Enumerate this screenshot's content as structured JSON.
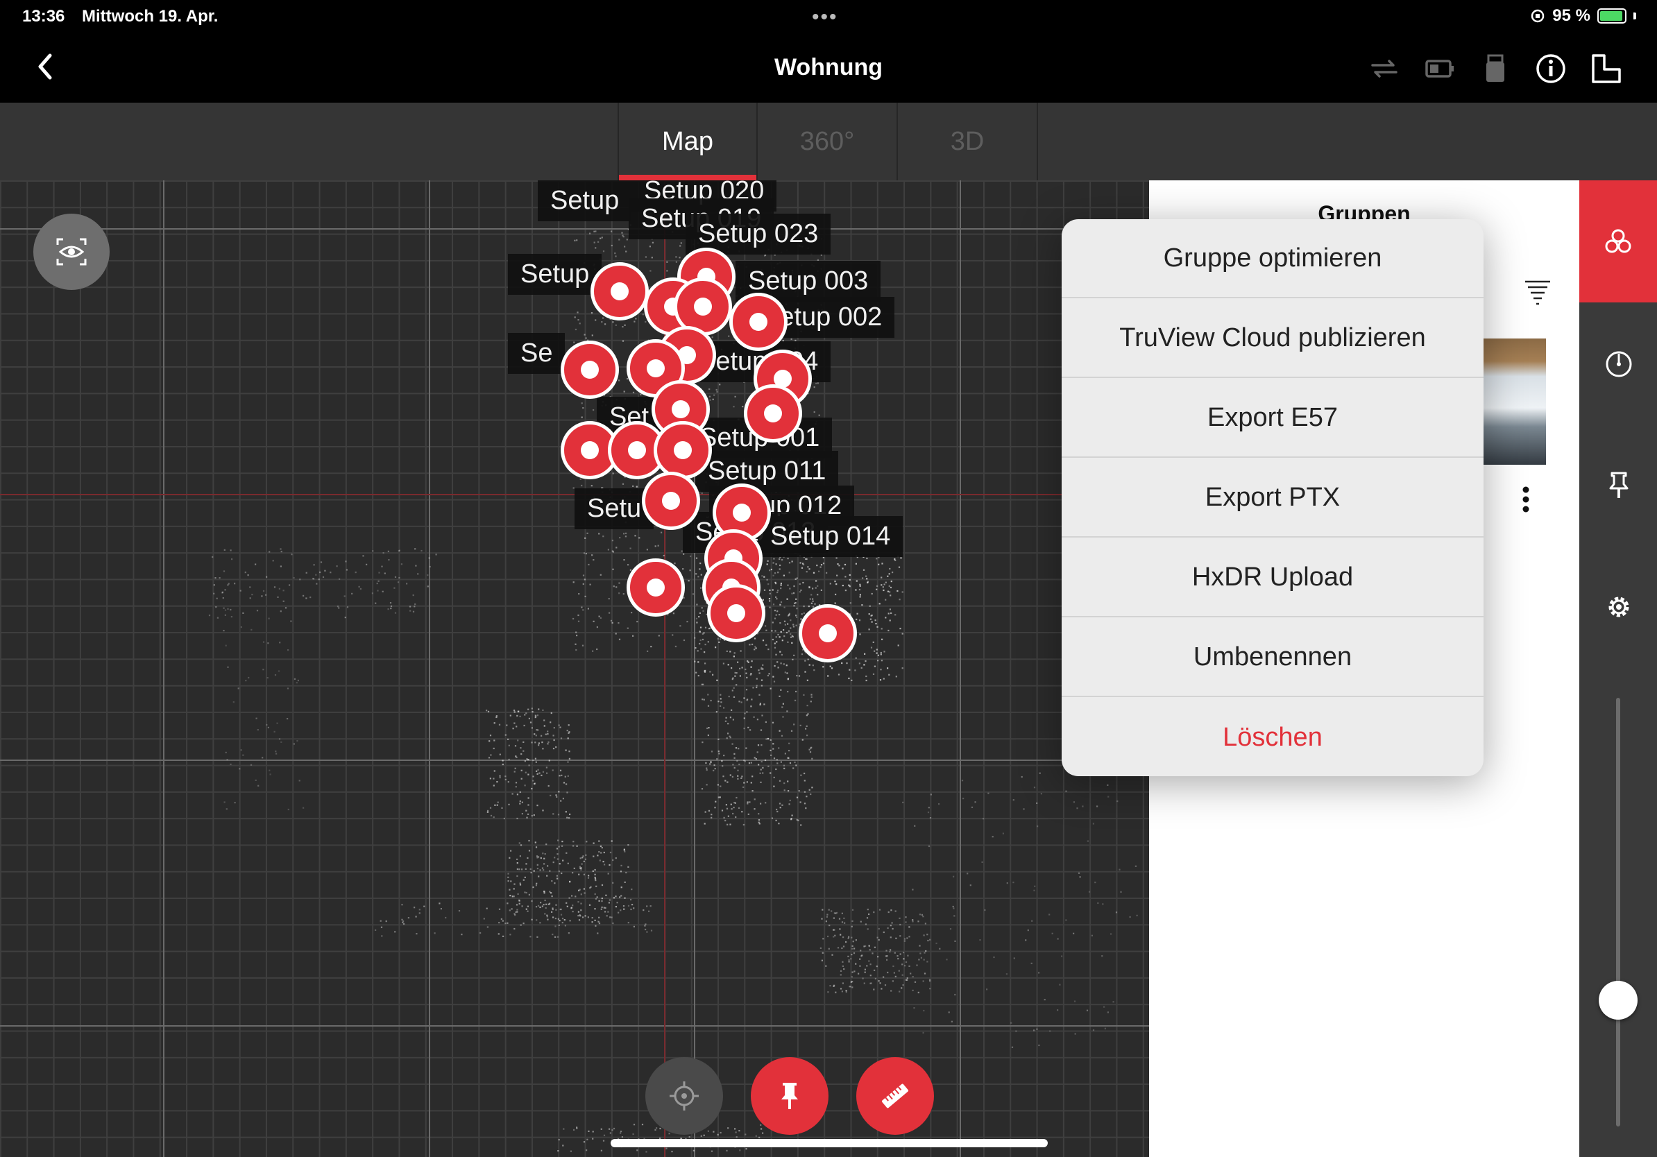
{
  "status_bar": {
    "time": "13:36",
    "date": "Mittwoch 19. Apr.",
    "dots": "•••",
    "battery_percent": "95 %"
  },
  "nav": {
    "back_icon": "chevron-left-icon",
    "title": "Wohnung",
    "icons": [
      "sync-icon",
      "battery-device-icon",
      "usb-device-icon",
      "info-icon",
      "layout-icon"
    ]
  },
  "tabs": [
    {
      "label": "Map",
      "active": true
    },
    {
      "label": "360°",
      "active": false
    },
    {
      "label": "3D",
      "active": false
    }
  ],
  "map": {
    "setups": [
      {
        "label": "Setup 020"
      },
      {
        "label": "Setup 019"
      },
      {
        "label": "Setup 023"
      },
      {
        "label": "Setup 003"
      },
      {
        "label": "Setup 002"
      },
      {
        "label": "Setup 004"
      },
      {
        "label": "Setup 001"
      },
      {
        "label": "Setup 011"
      },
      {
        "label": "Setup 012"
      },
      {
        "label": "Setup 013"
      },
      {
        "label": "Setup 014"
      }
    ],
    "partial_labels": [
      "Setup",
      "Setup",
      "Se",
      "Set",
      "Setu",
      "Se",
      "Setup"
    ],
    "buttons": [
      "locate-icon",
      "pin-icon",
      "measure-icon"
    ]
  },
  "panel": {
    "title": "Gruppen",
    "sort_icon": "sort-icon",
    "more_icon": "more-vertical-icon"
  },
  "sidebar": {
    "icons": [
      "groups-icon",
      "compass-icon",
      "pin-icon",
      "gear-icon"
    ],
    "slider_value": 0.3
  },
  "menu": {
    "items": [
      {
        "label": "Gruppe optimieren"
      },
      {
        "label": "TruView Cloud publizieren"
      },
      {
        "label": "Export E57"
      },
      {
        "label": "Export PTX"
      },
      {
        "label": "HxDR Upload"
      },
      {
        "label": "Umbenennen"
      },
      {
        "label": "Löschen",
        "danger": true
      }
    ]
  },
  "colors": {
    "accent": "#e2313a",
    "map_bg": "#2b2b2b",
    "bar_bg": "#000000"
  }
}
